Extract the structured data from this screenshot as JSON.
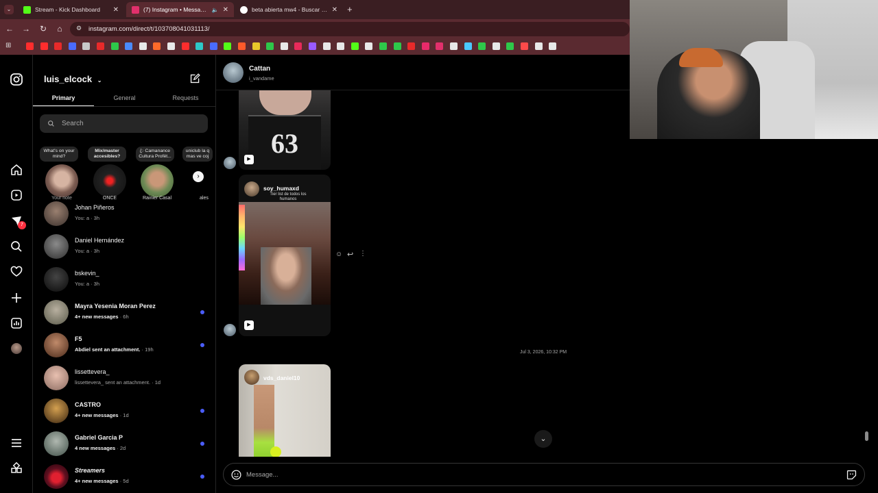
{
  "browser": {
    "tabs": [
      {
        "title": "Stream - Kick Dashboard",
        "favicon_color": "#53fc18"
      },
      {
        "title": "(7) Instagram • Messages",
        "favicon_color": "#e1306c"
      },
      {
        "title": "beta abierta mw4 - Buscar con",
        "favicon_color": "#4285f4"
      }
    ],
    "url": "instagram.com/direct/t/103708041031113/",
    "new_tab_label": "+"
  },
  "sidebar": {
    "notifications_badge": "7"
  },
  "inbox": {
    "username": "luis_elcock",
    "tabs": [
      "Primary",
      "General",
      "Requests"
    ],
    "search_placeholder": "Search",
    "notes": [
      {
        "text": "What's on your mind?"
      },
      {
        "text": "Mix/master accesibles?"
      },
      {
        "text": "ꦿ Camanance Cultura Profét..."
      },
      {
        "text": "uniclub la q mas ve coj"
      }
    ],
    "stories": [
      {
        "label": "Your note"
      },
      {
        "label": "ONCE"
      },
      {
        "label": "Rainier Casal"
      },
      {
        "label": "ales"
      }
    ],
    "conversations": [
      {
        "name": "Johan Piñeros",
        "preview": "You: a",
        "time": "· 3h",
        "unread": false
      },
      {
        "name": "Daniel Hernández",
        "preview": "You: a",
        "time": "· 3h",
        "unread": false
      },
      {
        "name": "bskevin_",
        "preview": "You: a",
        "time": "· 3h",
        "unread": false
      },
      {
        "name": "Mayra Yesenia Moran Perez",
        "preview": "4+ new messages",
        "time": "· 6h",
        "unread": true
      },
      {
        "name": "F5",
        "preview": "Abdiel sent an attachment.",
        "time": "· 19h",
        "unread": true
      },
      {
        "name": "lissettevera_",
        "preview": "lissettevera_ sent an attachment.",
        "time": "· 1d",
        "unread": false
      },
      {
        "name": "CASTRO",
        "preview": "4+ new messages",
        "time": "· 1d",
        "unread": true
      },
      {
        "name": "Gabriel Garcia P",
        "preview": "4 new messages",
        "time": "· 2d",
        "unread": true
      },
      {
        "name": "Streamers",
        "preview": "4+ new messages",
        "time": "· 5d",
        "unread": true
      }
    ]
  },
  "chat": {
    "peer_name": "Cattan",
    "peer_handle": "i_vandame",
    "reel1": {
      "author": "soy_humaxd",
      "caption": "Tier list de todos los humanos"
    },
    "reel2": {
      "author": "vds_daniel10"
    },
    "timestamp": "Jul 3, 2026, 10:32 PM",
    "composer_placeholder": "Message..."
  },
  "colors": {
    "unread_dot": "#4a5df9",
    "browser_frame": "#5a2a30"
  }
}
